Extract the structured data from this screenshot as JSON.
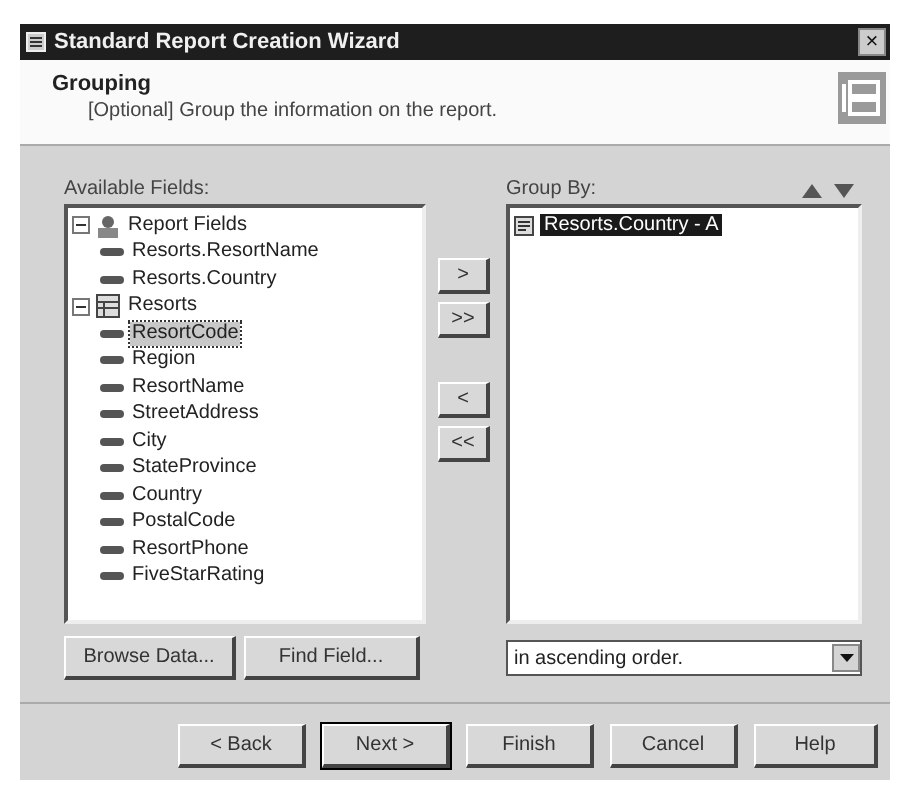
{
  "window": {
    "title": "Standard Report Creation Wizard",
    "close": "×"
  },
  "header": {
    "title": "Grouping",
    "subtitle": "[Optional] Group the information on the report."
  },
  "available_fields": {
    "label": "Available Fields:",
    "tree": [
      {
        "label": "Report Fields",
        "kind": "group",
        "expanded": true,
        "selected": false,
        "children": [
          {
            "label": "Resorts.ResortName",
            "kind": "field",
            "selected": false
          },
          {
            "label": "Resorts.Country",
            "kind": "field",
            "selected": false
          }
        ]
      },
      {
        "label": "Resorts",
        "kind": "table",
        "expanded": true,
        "selected": false,
        "children": [
          {
            "label": "ResortCode",
            "kind": "field",
            "selected": true
          },
          {
            "label": "Region",
            "kind": "field",
            "selected": false
          },
          {
            "label": "ResortName",
            "kind": "field",
            "selected": false
          },
          {
            "label": "StreetAddress",
            "kind": "field",
            "selected": false
          },
          {
            "label": "City",
            "kind": "field",
            "selected": false
          },
          {
            "label": "StateProvince",
            "kind": "field",
            "selected": false
          },
          {
            "label": "Country",
            "kind": "field",
            "selected": false
          },
          {
            "label": "PostalCode",
            "kind": "field",
            "selected": false
          },
          {
            "label": "ResortPhone",
            "kind": "field",
            "selected": false
          },
          {
            "label": "FiveStarRating",
            "kind": "field",
            "selected": false
          }
        ]
      }
    ]
  },
  "move_buttons": [
    ">",
    ">>",
    "<",
    "<<"
  ],
  "group_by": {
    "label": "Group By:",
    "items": [
      {
        "label": "Resorts.Country - A",
        "selected": true
      }
    ],
    "order": "in ascending order."
  },
  "field_buttons": [
    "Browse Data...",
    "Find Field..."
  ],
  "footer_buttons": [
    {
      "label": "< Back",
      "default": false
    },
    {
      "label": "Next >",
      "default": true
    },
    {
      "label": "Finish",
      "default": false
    },
    {
      "label": "Cancel",
      "default": false
    },
    {
      "label": "Help",
      "default": false
    }
  ]
}
